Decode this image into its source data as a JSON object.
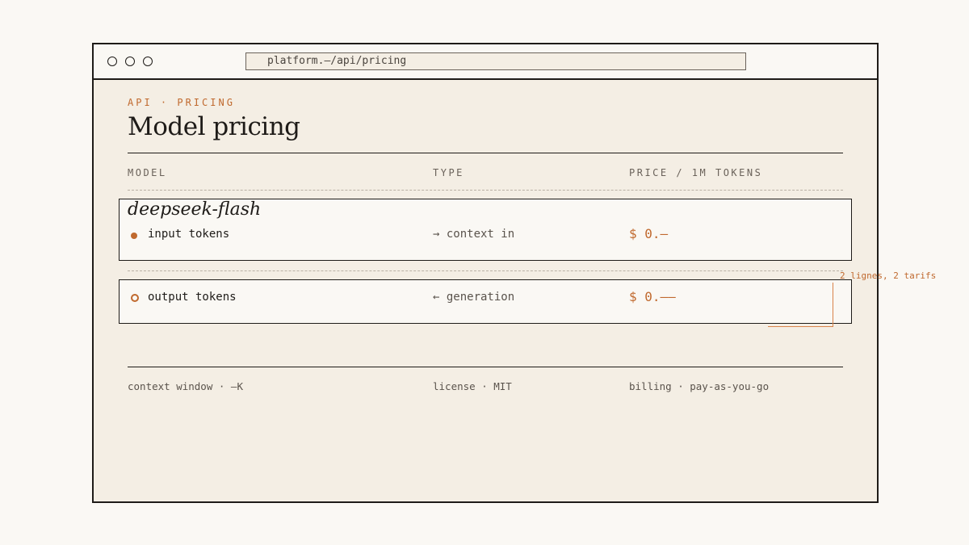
{
  "browser": {
    "url": "platform.–/api/pricing",
    "window_controls": [
      "circle-icon",
      "circle-icon",
      "circle-icon"
    ]
  },
  "page": {
    "eyebrow": "API · PRICING",
    "title": "Model pricing"
  },
  "table": {
    "headers": [
      "MODEL",
      "TYPE",
      "PRICE / 1M TOKENS"
    ],
    "model": "deepseek-flash",
    "rows": [
      {
        "label": "input tokens",
        "type": "→ context in",
        "price": "$ 0.–",
        "bullet": "filled-dot-icon"
      },
      {
        "label": "output tokens",
        "type": "← generation",
        "price": "$ 0.——",
        "bullet": "hollow-dot-icon"
      }
    ]
  },
  "footer": {
    "context": "context window · –K",
    "license": "license · MIT",
    "billing": "billing · pay-as-you-go"
  },
  "annotation": {
    "text": "2 lignes, 2 tarifs"
  },
  "colors": {
    "accent": "#c0692e",
    "ink": "#1e1b18",
    "paper": "#f4eee4",
    "background": "#faf8f4"
  }
}
